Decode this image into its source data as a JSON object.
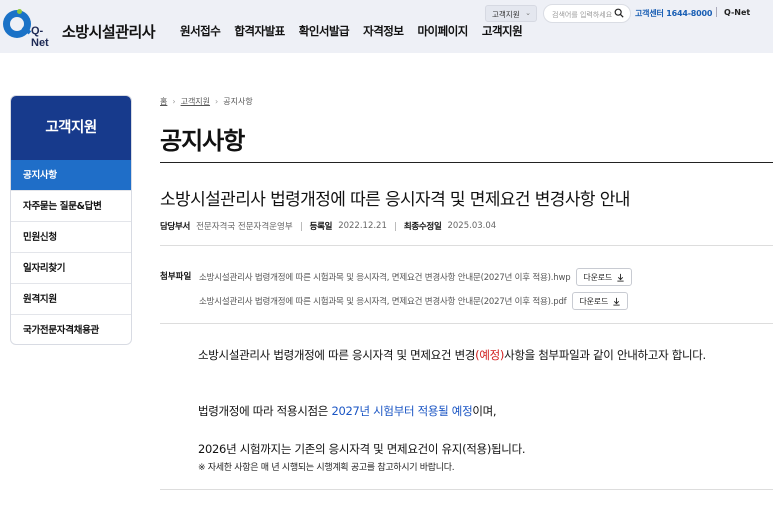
{
  "header": {
    "logo_text": "Q-Net",
    "site_title": "소방시설관리사",
    "nav": [
      "원서접수",
      "합격자발표",
      "확인서발급",
      "자격정보",
      "마이페이지",
      "고객지원"
    ],
    "util_select": "고객지원",
    "search_placeholder": "검색어를 입력하세요",
    "call_center": "고객센터 1644-8000",
    "qnet_link": "Q-Net"
  },
  "sidebar": {
    "title": "고객지원",
    "items": [
      {
        "label": "공지사항",
        "active": true
      },
      {
        "label": "자주묻는 질문&답변",
        "active": false
      },
      {
        "label": "민원신청",
        "active": false
      },
      {
        "label": "일자리찾기",
        "active": false
      },
      {
        "label": "원격지원",
        "active": false
      },
      {
        "label": "국가전문자격채용관",
        "active": false
      }
    ]
  },
  "breadcrumb": {
    "home": "홈",
    "section": "고객지원",
    "current": "공지사항"
  },
  "page_title": "공지사항",
  "post": {
    "title": "소방시설관리사 법령개정에 따른 응시자격 및 면제요건 변경사항 안내",
    "meta": {
      "dept_label": "담당부서",
      "dept": "전문자격국 전문자격운영부",
      "reg_label": "등록일",
      "reg_date": "2022.12.21",
      "mod_label": "최종수정일",
      "mod_date": "2025.03.04"
    },
    "attach_label": "첨부파일",
    "attachments": [
      {
        "name": "소방시설관리사 법령개정에 따른 시험과목 및 응시자격, 면제요건 변경사항 안내문(2027년 이후 적용).hwp",
        "button": "다운로드"
      },
      {
        "name": "소방시설관리사 법령개정에 따른 시험과목 및 응시자격, 면제요건 변경사항 안내문(2027년 이후 적용).pdf",
        "button": "다운로드"
      }
    ],
    "body": {
      "p1_a": "소방시설관리사 법령개정에 따른 응시자격 및 면제요건 변경",
      "p1_b": "(예정)",
      "p1_c": "사항을 첨부파일과 같이 안내하고자 합니다.",
      "p2_a": "법령개정에 따라 적용시점은 ",
      "p2_b": "2027년 시험부터 적용될 예정",
      "p2_c": "이며,",
      "p3": "2026년 시험까지는 기존의 응시자격 및 면제요건이 유지(적용)됩니다.",
      "p4": "※ 자세한 사항은 매 년 시행되는 시행계획 공고를 참고하시기 바랍니다."
    }
  },
  "colors": {
    "brand": "#173a8c",
    "active": "#1f6ec8",
    "highlight_red": "#d21f1f",
    "highlight_blue": "#1a55c4"
  }
}
